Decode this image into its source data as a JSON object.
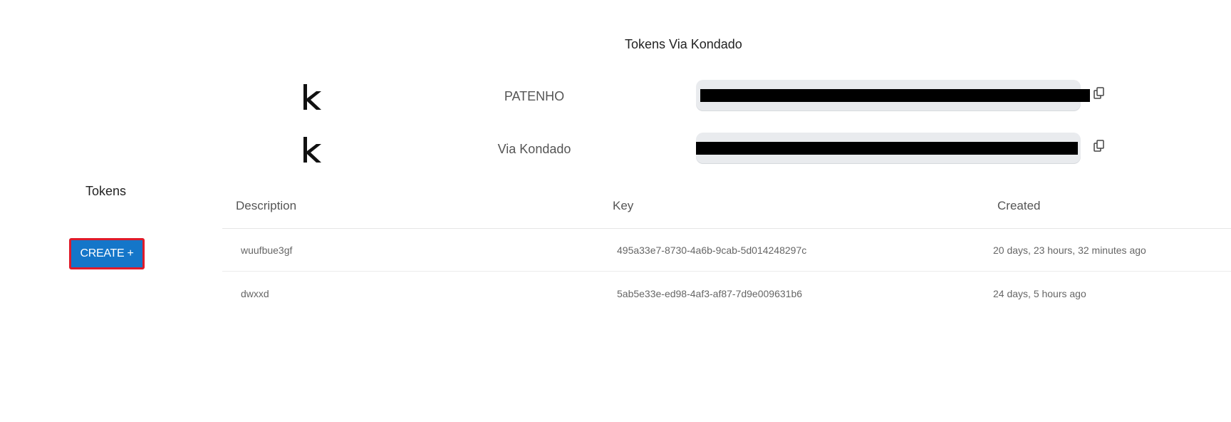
{
  "page": {
    "title": "Tokens Via Kondado"
  },
  "accounts": [
    {
      "name": "PATENHO",
      "logo_icon": "kondado-k-logo",
      "token_value": "",
      "copy_icon": "copy-icon"
    },
    {
      "name": "Via Kondado",
      "logo_icon": "kondado-k-logo",
      "token_value": "",
      "copy_icon": "copy-icon"
    }
  ],
  "sidebar": {
    "heading": "Tokens",
    "create_button_label": "CREATE +"
  },
  "table": {
    "columns": [
      "Description",
      "Key",
      "Created"
    ],
    "rows": [
      {
        "description": "wuufbue3gf",
        "key": "495a33e7-8730-4a6b-9cab-5d014248297c",
        "created": "20 days, 23 hours, 32 minutes ago"
      },
      {
        "description": "dwxxd",
        "key": "5ab5e33e-ed98-4af3-af87-7d9e009631b6",
        "created": "24 days, 5 hours ago"
      }
    ]
  },
  "colors": {
    "create_button_bg": "#1476c9",
    "create_button_border": "#e01b2a",
    "token_field_bg": "#e9ebee"
  }
}
